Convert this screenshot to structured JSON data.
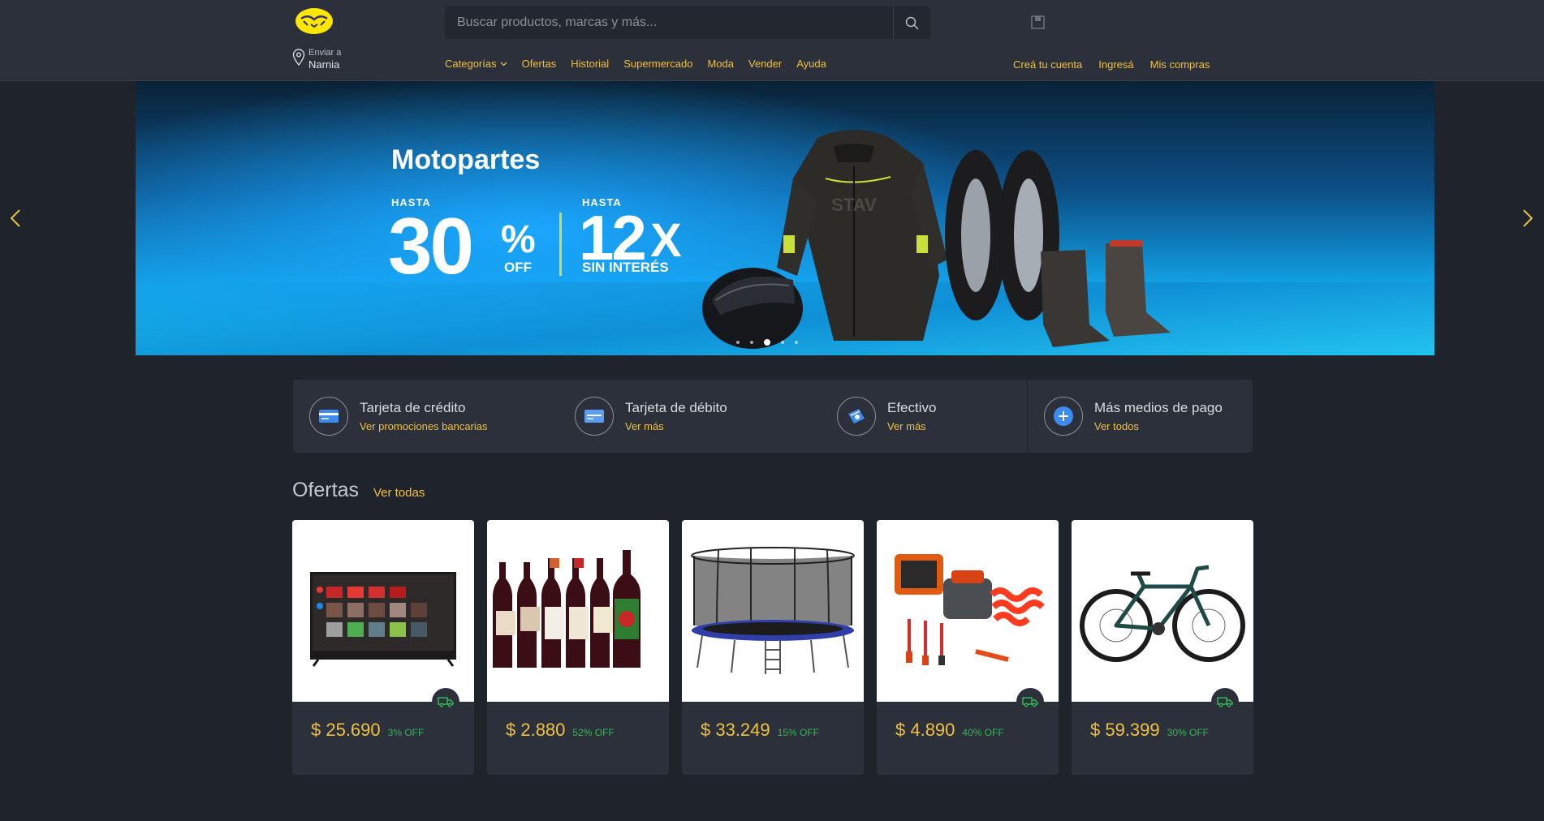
{
  "header": {
    "search": {
      "placeholder": "Buscar productos, marcas y más..."
    },
    "shipping": {
      "label": "Enviar a",
      "location": "Narnia"
    },
    "nav": [
      {
        "label": "Categorías"
      },
      {
        "label": "Ofertas"
      },
      {
        "label": "Historial"
      },
      {
        "label": "Supermercado"
      },
      {
        "label": "Moda"
      },
      {
        "label": "Vender"
      },
      {
        "label": "Ayuda"
      }
    ],
    "user_nav": [
      {
        "label": "Creá tu cuenta"
      },
      {
        "label": "Ingresá"
      },
      {
        "label": "Mis compras"
      }
    ]
  },
  "hero": {
    "title": "Motopartes",
    "deal1": {
      "prefix": "HASTA",
      "value": "30",
      "unit": "%",
      "suffix": "OFF"
    },
    "deal2": {
      "prefix": "HASTA",
      "value": "12",
      "unit": "X",
      "suffix": "SIN INTERÉS"
    },
    "slide_count": 5,
    "active_slide": 3
  },
  "payments": [
    {
      "title": "Tarjeta de crédito",
      "link": "Ver promociones bancarias",
      "icon": "credit-card-icon"
    },
    {
      "title": "Tarjeta de débito",
      "link": "Ver más",
      "icon": "debit-card-icon"
    },
    {
      "title": "Efectivo",
      "link": "Ver más",
      "icon": "cash-icon"
    },
    {
      "title": "Más medios de pago",
      "link": "Ver todos",
      "icon": "plus-icon"
    }
  ],
  "offers": {
    "title": "Ofertas",
    "link": "Ver todas",
    "items": [
      {
        "price": "$ 25.690",
        "discount": "3% OFF",
        "image": "smart-tv",
        "free_shipping": true
      },
      {
        "price": "$ 2.880",
        "discount": "52% OFF",
        "image": "wine-bottles",
        "free_shipping": false
      },
      {
        "price": "$ 33.249",
        "discount": "15% OFF",
        "image": "trampoline",
        "free_shipping": false
      },
      {
        "price": "$ 4.890",
        "discount": "40% OFF",
        "image": "tool-kit-compressor",
        "free_shipping": true
      },
      {
        "price": "$ 59.399",
        "discount": "30% OFF",
        "image": "mountain-bike",
        "free_shipping": true
      }
    ]
  },
  "colors": {
    "background": "#1f232b",
    "panel": "#2b303a",
    "accent": "#f0c13f",
    "discount": "#34b559"
  }
}
